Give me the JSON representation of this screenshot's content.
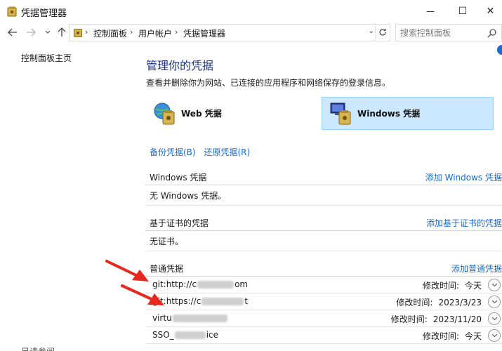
{
  "window": {
    "title": "凭据管理器",
    "minimize": "—",
    "maximize": "☐",
    "close": "✕"
  },
  "nav": {
    "breadcrumb": [
      "控制面板",
      "用户帐户",
      "凭据管理器"
    ],
    "search_placeholder": "搜索控制面板"
  },
  "sidebar": {
    "home": "控制面板主页",
    "see_also": "另请参阅"
  },
  "main": {
    "title": "管理你的凭据",
    "description": "查看并删除你为网站、已连接的应用程序和网络保存的登录信息。",
    "tiles": {
      "web": "Web 凭据",
      "windows": "Windows 凭据"
    },
    "backup_link": "备份凭据(B)",
    "restore_link": "还原凭据(R)"
  },
  "sections": {
    "windows": {
      "title": "Windows 凭据",
      "add": "添加 Windows 凭据",
      "empty": "无 Windows 凭据。"
    },
    "certificate": {
      "title": "基于证书的凭据",
      "add": "添加基于证书的凭据",
      "empty": "无证书。"
    },
    "generic": {
      "title": "普通凭据",
      "add": "添加普通凭据",
      "items": [
        {
          "prefix": "git:http://c",
          "suffix": "om",
          "modified_label": "修改时间:",
          "modified": "今天"
        },
        {
          "prefix": "git:https://c",
          "suffix": "t",
          "modified_label": "修改时间:",
          "modified": "2023/3/23"
        },
        {
          "prefix": "virtu",
          "suffix": "",
          "modified_label": "修改时间:",
          "modified": "2023/11/20"
        },
        {
          "prefix": "SSO_",
          "suffix": "ice",
          "modified_label": "修改时间:",
          "modified": "今天"
        }
      ]
    }
  },
  "colors": {
    "link": "#1a6bd6",
    "title": "#1e3287",
    "selected_tile": "#cce8ff",
    "annotation_arrow": "#e8281e"
  }
}
